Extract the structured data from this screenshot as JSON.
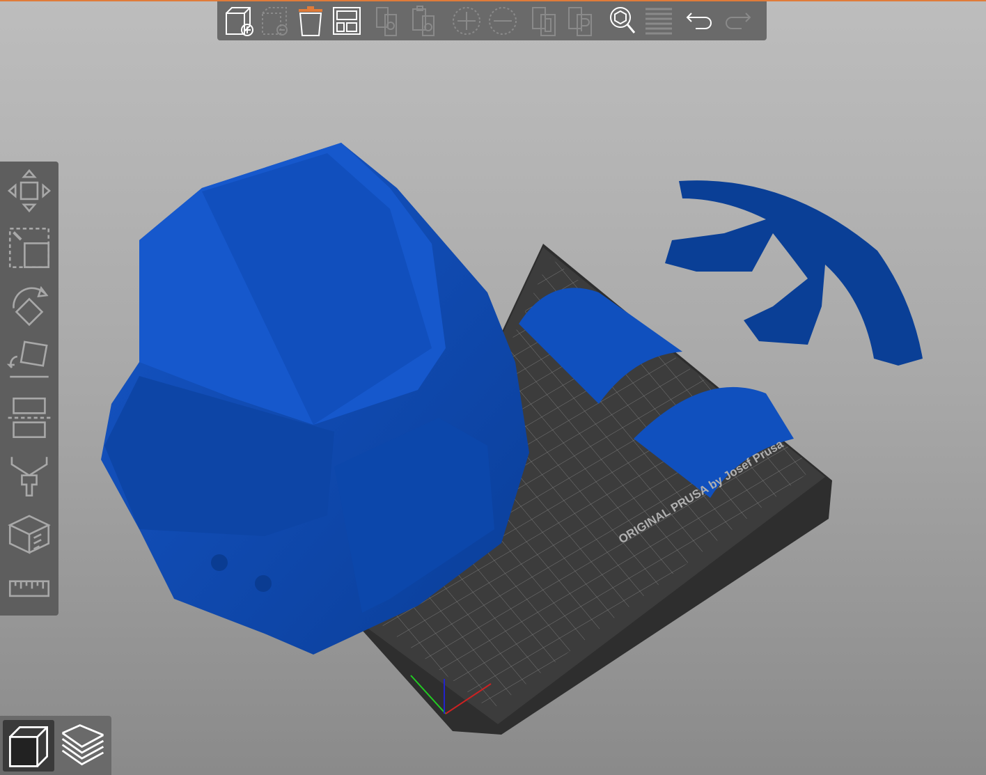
{
  "app": "PrusaSlicer 3D view",
  "colors": {
    "accent": "#e07b39",
    "object": "#0b4aa8",
    "bed": "#3a3a3a",
    "toolbar": "#6a6a6a"
  },
  "top_toolbar": [
    {
      "icon": "add-object-icon",
      "enabled": true
    },
    {
      "icon": "delete-object-icon",
      "enabled": false
    },
    {
      "icon": "delete-all-icon",
      "enabled": true,
      "highlighted": true
    },
    {
      "icon": "arrange-icon",
      "enabled": true
    },
    {
      "icon": "copy-icon",
      "enabled": false
    },
    {
      "icon": "paste-icon",
      "enabled": false
    },
    {
      "icon": "add-instance-icon",
      "enabled": false
    },
    {
      "icon": "remove-instance-icon",
      "enabled": false
    },
    {
      "icon": "split-objects-icon",
      "enabled": false
    },
    {
      "icon": "split-parts-icon",
      "enabled": false
    },
    {
      "icon": "search-icon",
      "enabled": true
    },
    {
      "icon": "layers-editing-icon",
      "enabled": false
    },
    {
      "icon": "undo-icon",
      "enabled": true
    },
    {
      "icon": "redo-icon",
      "enabled": false
    }
  ],
  "left_toolbar": [
    "move-icon",
    "scale-icon",
    "rotate-icon",
    "place-on-face-icon",
    "cut-icon",
    "paint-supports-icon",
    "sla-hollow-icon",
    "measure-icon"
  ],
  "view_toggle": [
    {
      "icon": "3d-view-icon",
      "active": true
    },
    {
      "icon": "preview-layers-icon",
      "active": false
    }
  ],
  "bed_logo": "ORIGINAL PRUSA by Josef Prusa"
}
